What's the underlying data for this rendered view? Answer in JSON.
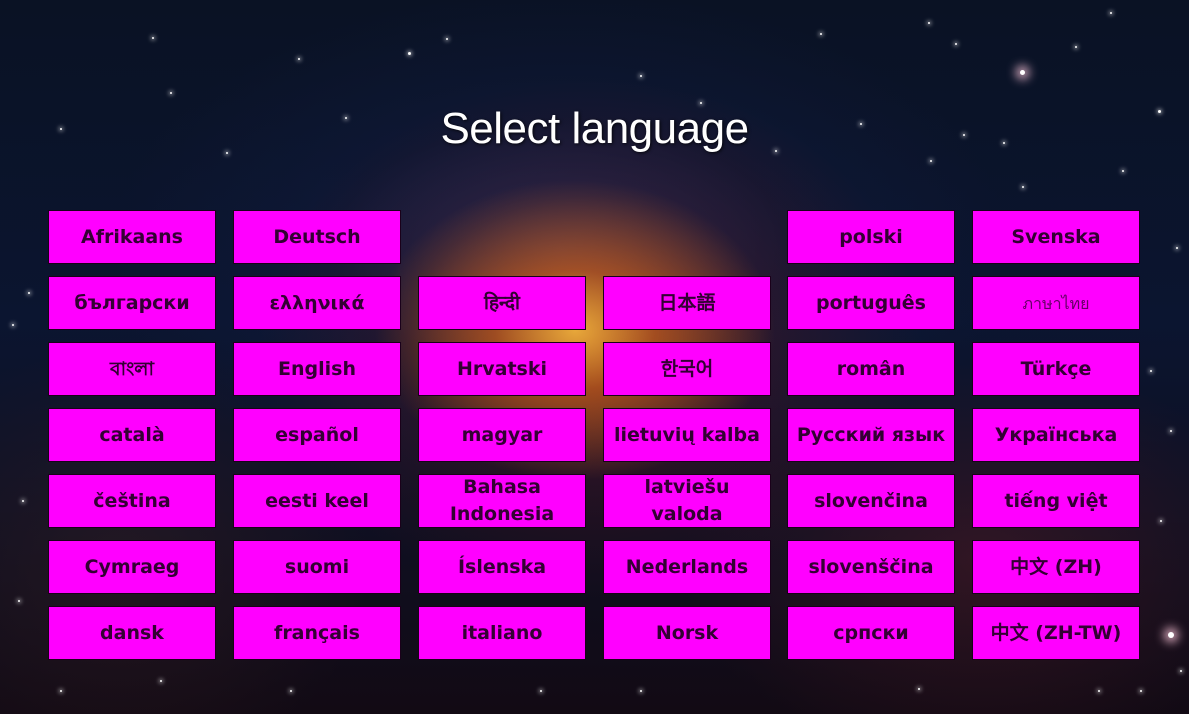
{
  "title": "Select language",
  "colors": {
    "button_bg": "#ff00ff",
    "button_text": "#330033",
    "title": "#ffffff"
  },
  "languages": [
    "Afrikaans",
    "Deutsch",
    "polski",
    "Svenska",
    "български",
    "ελληνικά",
    "हिन्दी",
    "日本語",
    "português",
    "ภาษาไทย",
    "বাংলা",
    "English",
    "Hrvatski",
    "한국어",
    "român",
    "Türkçe",
    "català",
    "español",
    "magyar",
    "lietuvių kalba",
    "Русский язык",
    "Українська",
    "čeština",
    "eesti keel",
    "Bahasa Indonesia",
    "latviešu valoda",
    "slovenčina",
    "tiếng việt",
    "Cymraeg",
    "suomi",
    "Íslenska",
    "Nederlands",
    "slovenščina",
    "中文 (ZH)",
    "dansk",
    "français",
    "italiano",
    "Norsk",
    "српски",
    "中文 (ZH-TW)"
  ]
}
